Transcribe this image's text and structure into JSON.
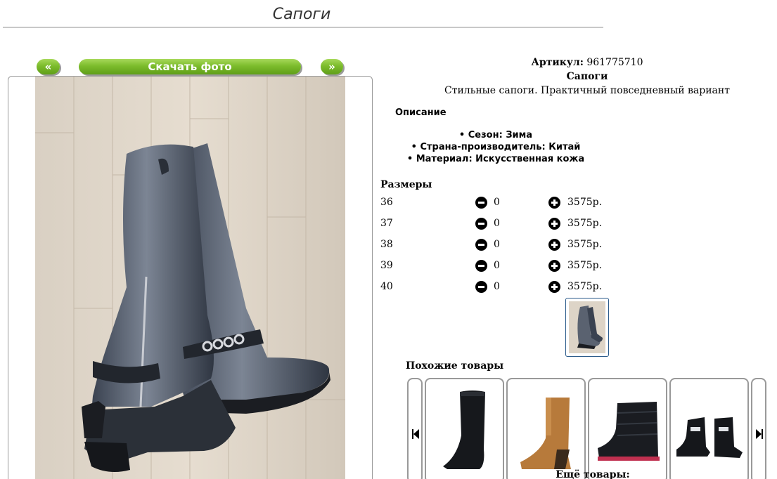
{
  "page": {
    "title": "Сапоги"
  },
  "nav": {
    "prev_label": "«",
    "download_label": "Скачать фото",
    "next_label": "»"
  },
  "product": {
    "article_label": "Артикул:",
    "article_value": "961775710",
    "name": "Сапоги",
    "short_description": "Стильные сапоги. Практичный повседневный вариант",
    "description_heading": "Описание",
    "features": [
      "Сезон: Зима",
      "Страна-производитель: Китай",
      "Материал: Искусственная кожа"
    ]
  },
  "sizes": {
    "heading": "Размеры",
    "rows": [
      {
        "size": "36",
        "qty": "0",
        "price": "3575р."
      },
      {
        "size": "37",
        "qty": "0",
        "price": "3575р."
      },
      {
        "size": "38",
        "qty": "0",
        "price": "3575р."
      },
      {
        "size": "39",
        "qty": "0",
        "price": "3575р."
      },
      {
        "size": "40",
        "qty": "0",
        "price": "3575р."
      }
    ]
  },
  "similar": {
    "heading": "Похожие товары",
    "items": [
      {
        "icon": "black-leather-boot"
      },
      {
        "icon": "tan-leather-boot"
      },
      {
        "icon": "black-quilted-boot"
      },
      {
        "icon": "black-kids-boots"
      }
    ]
  },
  "more": {
    "heading": "Ещё товары:"
  },
  "colors": {
    "button_green": "#7cbc2c",
    "frame_border": "#999999",
    "thumb_border": "#2a5a8a"
  }
}
